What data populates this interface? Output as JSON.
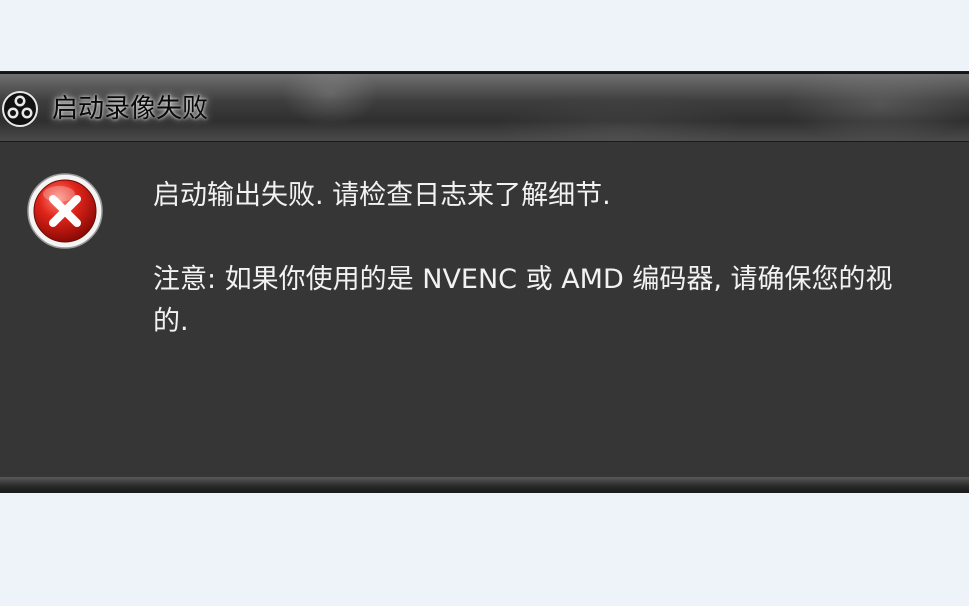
{
  "dialog": {
    "title": "启动录像失败",
    "icon": "obs-logo-icon"
  },
  "content": {
    "icon": "error-icon",
    "message_line1": "启动输出失败. 请检查日志来了解细节.",
    "message_line2": "注意: 如果你使用的是 NVENC 或 AMD 编码器, 请确保您的视",
    "message_line3": "的."
  }
}
